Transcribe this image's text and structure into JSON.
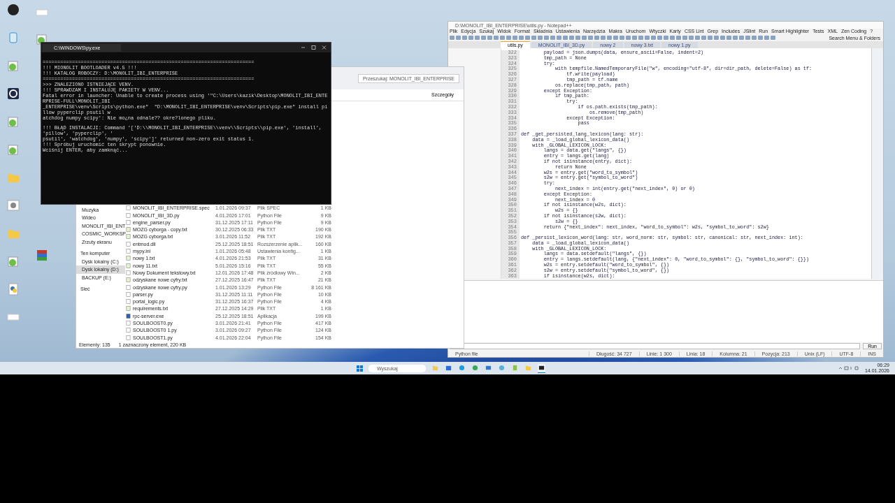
{
  "desktop": {
    "icons_left": [
      {
        "kind": "camera"
      },
      {
        "kind": "recycle"
      },
      {
        "kind": "notepad"
      },
      {
        "kind": "webcam"
      },
      {
        "kind": "notepad"
      },
      {
        "kind": "notepad"
      },
      {
        "kind": "folder"
      },
      {
        "kind": "gear"
      },
      {
        "kind": "folder"
      },
      {
        "kind": "notepad"
      },
      {
        "kind": "python"
      },
      {
        "kind": "blank"
      }
    ],
    "icons_right": [
      {
        "kind": "blank"
      },
      {
        "kind": "notepad"
      },
      {
        "kind": "winrar"
      }
    ]
  },
  "terminal": {
    "title": "C:\\WINDOWS\\py.exe",
    "blocks": [
      [
        "========================================================================",
        "!!! MIONOLIT BOOTLOADER v4.5 !!!",
        "!!! KATALOG ROBOCZY: D:\\MONOLIT_IBI_ENTERPRISE",
        "========================================================================",
        ">>> ZNALEZIONO ISTNIEJĄCE VENV.",
        "!!! SPRAWDZAM I INSTALUJĘ PAKIETY W VENV...",
        "Fatal error in launcher: Unable to create process using '\"C:\\Users\\kazik\\Desktop\\MONOLIT_IBI_ENTERPRISE-FULL\\MONOLIT_IBI",
        "_ENTERPRISE\\venv\\Scripts\\python.exe\"  \"D:\\MONOLIT_IBI_ENTERPRISE\\venv\\Scripts\\pip.exe\" install pillow pyperclip psutil w",
        "atchdog numpy scipy': Nie mo¿na odnale?? okre?lonego pliku."
      ],
      [
        "!!! BŁĄD INSTALACJI: Command '['D:\\\\MONOLIT_IBI_ENTERPRISE\\\\venv\\\\Scripts\\\\pip.exe', 'install', 'pillow', 'pyperclip', '",
        "psutil', 'watchdog', 'numpy', 'scipy']' returned non-zero exit status 1.",
        "!!! Spróbuj uruchomić ten skrypt ponownie.",
        "Wciśnij ENTER, aby zamknąć..."
      ]
    ]
  },
  "explorer": {
    "search": {
      "placeholder": "Przeszukaj: MONOLIT_IBI_ENTERPRISE"
    },
    "view_button": "Szczegóły",
    "nav": [
      {
        "label": "Muzyka",
        "kind": "music",
        "selected": false
      },
      {
        "label": "Wideo",
        "kind": "video",
        "selected": false
      },
      {
        "label": "MONOLIT_IBI_ENT",
        "kind": "folder",
        "selected": false
      },
      {
        "label": "COSMIC_WORKSP",
        "kind": "folder",
        "selected": false
      },
      {
        "label": "Zrzuty ekranu",
        "kind": "folder",
        "selected": false
      },
      {
        "label": "Ten komputer",
        "kind": "pc",
        "selected": false
      },
      {
        "label": "Dysk lokalny (C:)",
        "kind": "drive",
        "selected": false
      },
      {
        "label": "Dysk lokalny (D:)",
        "kind": "drive",
        "selected": true
      },
      {
        "label": "BACKUP (E:)",
        "kind": "drive",
        "selected": false
      },
      {
        "label": "Sieć",
        "kind": "network",
        "selected": false
      }
    ],
    "files": [
      {
        "name": "MONOLIT_IBI_ENTERPRISE.spec",
        "date": "1.01.2026 09:37",
        "type": "Plik SPEC",
        "size": "1 KB",
        "kind": "doc"
      },
      {
        "name": "MONOLIT_IBI_3D.py",
        "date": "4.01.2026 17:01",
        "type": "Python File",
        "size": "9 KB",
        "kind": "doc"
      },
      {
        "name": "engine_parser.py",
        "date": "31.12.2025 17:11",
        "type": "Python File",
        "size": "9 KB",
        "kind": "doc"
      },
      {
        "name": "MOZG cyborga - copy.txt",
        "date": "30.12.2025 06:33",
        "type": "Plik TXT",
        "size": "190 KB",
        "kind": "notepad"
      },
      {
        "name": "MOZG cyborga.txt",
        "date": "3.01.2026 11:52",
        "type": "Plik TXT",
        "size": "192 KB",
        "kind": "notepad"
      },
      {
        "name": "entmod.dll",
        "date": "25.12.2025 18:51",
        "type": "Rozszerzenie aplik...",
        "size": "160 KB",
        "kind": "doc"
      },
      {
        "name": "mypy.ini",
        "date": "1.01.2026 05:48",
        "type": "Ustawienia konfig...",
        "size": "1 KB",
        "kind": "doc"
      },
      {
        "name": "nowy 1.txt",
        "date": "4.01.2026 21:53",
        "type": "Plik TXT",
        "size": "31 KB",
        "kind": "notepad"
      },
      {
        "name": "nowy 11.txt",
        "date": "5.01.2026 15:16",
        "type": "Plik TXT",
        "size": "55 KB",
        "kind": "notepad"
      },
      {
        "name": "Nowy Dokument tekstowy.txt",
        "date": "12.01.2026 17:48",
        "type": "Plik źródłowy Win...",
        "size": "2 KB",
        "kind": "doc"
      },
      {
        "name": "odzyskane nowe cyfry.txt",
        "date": "27.12.2025 16:47",
        "type": "Plik TXT",
        "size": "21 KB",
        "kind": "notepad"
      },
      {
        "name": "odzyskane nowe cyfry.py",
        "date": "1.01.2026 13:29",
        "type": "Python File",
        "size": "8 161 KB",
        "kind": "doc"
      },
      {
        "name": "parser.py",
        "date": "31.12.2025 11:11",
        "type": "Python File",
        "size": "10 KB",
        "kind": "doc"
      },
      {
        "name": "portal_logic.py",
        "date": "31.12.2025 16:37",
        "type": "Python File",
        "size": "4 KB",
        "kind": "doc"
      },
      {
        "name": "requirements.txt",
        "date": "27.12.2025 14:29",
        "type": "Plik TXT",
        "size": "1 KB",
        "kind": "notepad"
      },
      {
        "name": "rpc-server.exe",
        "date": "25.12.2025 18:51",
        "type": "Aplikacja",
        "size": "199 KB",
        "kind": "app"
      },
      {
        "name": "SOULBOOST0.py",
        "date": "3.01.2026 21:41",
        "type": "Python File",
        "size": "417 KB",
        "kind": "doc"
      },
      {
        "name": "SOULBOOST0 1.py",
        "date": "3.01.2026 09:27",
        "type": "Python File",
        "size": "124 KB",
        "kind": "doc"
      },
      {
        "name": "SOULBOOST1.py",
        "date": "4.01.2026 22:04",
        "type": "Python File",
        "size": "154 KB",
        "kind": "doc"
      }
    ],
    "status": {
      "count": "Elementy: 135",
      "selection": "1 zaznaczony element, 220 KB"
    }
  },
  "editor": {
    "title": "D:\\MONOLIT_IBI_ENTERPRISE\\utils.py - Notepad++",
    "menu": [
      "Plik",
      "Edycja",
      "Szukaj",
      "Widok",
      "Format",
      "Składnia",
      "Ustawienia",
      "Narzędzia",
      "Makra",
      "Uruchom",
      "Wtyczki",
      "Karty",
      "CSS Lint",
      "Grep",
      "Includes",
      "JSlint",
      "Run",
      "Smart Highlighter",
      "Tests",
      "XML",
      "Zen Coding",
      "?"
    ],
    "toolbar_search": "Search Menu & Folders",
    "tabs": [
      {
        "label": "utils.py",
        "selected": true
      },
      {
        "label": "MONOLIT_IBI_3D.py",
        "selected": false
      },
      {
        "label": "nowy 2",
        "selected": false
      },
      {
        "label": "nowy 3.txt",
        "selected": false
      },
      {
        "label": "nowy 1.py",
        "selected": false
      }
    ],
    "lines": [
      {
        "number": "322",
        "text": "        payload = json.dumps(data, ensure_ascii=False, indent=2)"
      },
      {
        "number": "323",
        "text": "        tmp_path = None"
      },
      {
        "number": "324",
        "text": "        try:"
      },
      {
        "number": "325",
        "text": "            with tempfile.NamedTemporaryFile(\"w\", encoding=\"utf-8\", dir=dir_path, delete=False) as tf:"
      },
      {
        "number": "326",
        "text": "                tf.write(payload)"
      },
      {
        "number": "327",
        "text": "                tmp_path = tf.name"
      },
      {
        "number": "328",
        "text": "            os.replace(tmp_path, path)"
      },
      {
        "number": "329",
        "text": "        except Exception:"
      },
      {
        "number": "330",
        "text": "            if tmp_path:"
      },
      {
        "number": "331",
        "text": "                try:"
      },
      {
        "number": "332",
        "text": "                    if os.path.exists(tmp_path):"
      },
      {
        "number": "333",
        "text": "                        os.remove(tmp_path)"
      },
      {
        "number": "334",
        "text": "                except Exception:"
      },
      {
        "number": "335",
        "text": "                    pass"
      },
      {
        "number": "336"
      },
      {
        "number": "337",
        "text": "def _get_persisted_lang_lexicon(lang: str):"
      },
      {
        "number": "338",
        "text": "    data = _load_global_lexicon_data()"
      },
      {
        "number": "339",
        "text": "    with _GLOBAL_LEXICON_LOCK:"
      },
      {
        "number": "340",
        "text": "        langs = data.get(\"langs\", {})"
      },
      {
        "number": "341",
        "text": "        entry = langs.get(lang)"
      },
      {
        "number": "342",
        "text": "        if not isinstance(entry, dict):"
      },
      {
        "number": "343",
        "text": "            return None"
      },
      {
        "number": "344",
        "text": "        w2s = entry.get(\"word_to_symbol\")"
      },
      {
        "number": "345",
        "text": "        s2w = entry.get(\"symbol_to_word\")"
      },
      {
        "number": "346",
        "text": "        try:"
      },
      {
        "number": "347",
        "text": "            next_index = int(entry.get(\"next_index\", 0) or 0)"
      },
      {
        "number": "348",
        "text": "        except Exception:"
      },
      {
        "number": "349",
        "text": "            next_index = 0"
      },
      {
        "number": "350",
        "text": "        if not isinstance(w2s, dict):"
      },
      {
        "number": "351",
        "text": "            w2s = {}"
      },
      {
        "number": "352",
        "text": "        if not isinstance(s2w, dict):"
      },
      {
        "number": "353",
        "text": "            s2w = {}"
      },
      {
        "number": "354",
        "text": "        return {\"next_index\": next_index, \"word_to_symbol\": w2s, \"symbol_to_word\": s2w}"
      },
      {
        "number": "355"
      },
      {
        "number": "356",
        "text": "def _persist_lexicon_word(lang: str, word_norm: str, symbol: str, canonical: str, next_index: int):"
      },
      {
        "number": "357",
        "text": "    data = _load_global_lexicon_data()"
      },
      {
        "number": "358",
        "text": "    with _GLOBAL_LEXICON_LOCK:"
      },
      {
        "number": "359",
        "text": "        langs = data.setdefault(\"langs\", {})"
      },
      {
        "number": "360",
        "text": "        entry = langs.setdefault(lang, {\"next_index\": 0, \"word_to_symbol\": {}, \"symbol_to_word\": {}})"
      },
      {
        "number": "361",
        "text": "        w2s = entry.setdefault(\"word_to_symbol\", {})"
      },
      {
        "number": "362",
        "text": "        s2w = entry.setdefault(\"symbol_to_word\", {})"
      },
      {
        "number": "363",
        "text": "        if isinstance(w2s, dict):"
      }
    ],
    "run_button": "Run",
    "status": [
      "Python file",
      "Długość: 34 727",
      "Linie: 1 300",
      "Linia: 18",
      "Kolumna: 21",
      "Pozycja: 213",
      "Unix (LF)",
      "UTF-8",
      "INS"
    ]
  },
  "taskbar": {
    "search": {
      "placeholder": "Wyszukaj"
    },
    "apps": [
      {
        "kind": "files",
        "active": false
      },
      {
        "kind": "store",
        "active": false
      },
      {
        "kind": "edge",
        "active": false
      },
      {
        "kind": "chrome",
        "active": false
      },
      {
        "kind": "mail",
        "active": false
      },
      {
        "kind": "network",
        "active": false
      },
      {
        "kind": "notepad",
        "active": false
      },
      {
        "kind": "files",
        "active": false
      },
      {
        "kind": "terminal",
        "active": true
      }
    ],
    "time": "06:29",
    "date": "14.01.2026"
  }
}
